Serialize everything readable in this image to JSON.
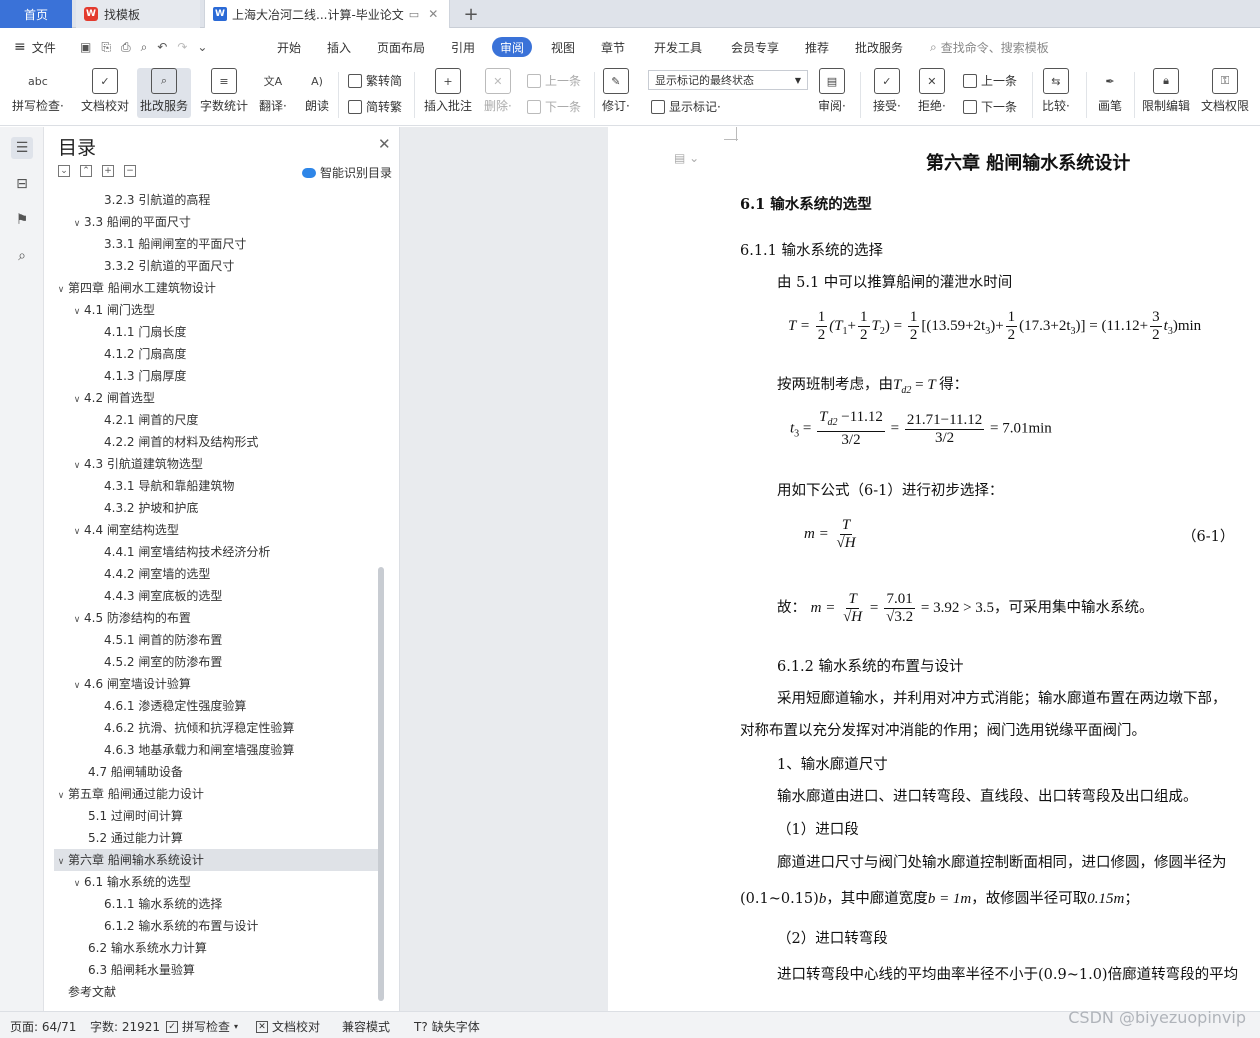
{
  "tabs": {
    "home": "首页",
    "find_template": "找模板",
    "doc": "上海大冶河二线...计算-毕业论文",
    "add": "+"
  },
  "menu": {
    "file": "文件",
    "items": [
      "开始",
      "插入",
      "页面布局",
      "引用",
      "审阅",
      "视图",
      "章节",
      "开发工具",
      "会员专享",
      "推荐",
      "批改服务"
    ],
    "search": "查找命令、搜索模板"
  },
  "ribbon": {
    "spell": "拼写检查·",
    "proof": "文档校对",
    "correct": "批改服务",
    "wordcount": "字数统计",
    "translate": "翻译·",
    "read": "朗读",
    "trad": "繁转简",
    "simp": "简转繁",
    "insert_comment": "插入批注",
    "delete": "删除·",
    "prev": "上一条",
    "next": "下一条",
    "revise": "修订·",
    "markup_state": "显示标记的最终状态",
    "show_markup": "显示标记·",
    "review": "审阅·",
    "accept": "接受·",
    "reject": "拒绝·",
    "prev2": "上一条",
    "next2": "下一条",
    "compare": "比较·",
    "pen": "画笔",
    "restrict": "限制编辑",
    "permission": "文档权限"
  },
  "toc": {
    "title": "目录",
    "smart": "智能识别目录",
    "items": [
      {
        "text": "3.2.3 引航道的高程",
        "level": 3,
        "chev": ""
      },
      {
        "text": "3.3 船闸的平面尺寸",
        "level": 2,
        "chev": "v"
      },
      {
        "text": "3.3.1 船闸闸室的平面尺寸",
        "level": 3,
        "chev": ""
      },
      {
        "text": "3.3.2 引航道的平面尺寸",
        "level": 3,
        "chev": ""
      },
      {
        "text": "第四章  船闸水工建筑物设计",
        "level": 1,
        "chev": "v"
      },
      {
        "text": "4.1 闸门选型",
        "level": 2,
        "chev": "v"
      },
      {
        "text": "4.1.1 门扇长度",
        "level": 3,
        "chev": ""
      },
      {
        "text": "4.1.2 门扇高度",
        "level": 3,
        "chev": ""
      },
      {
        "text": "4.1.3 门扇厚度",
        "level": 3,
        "chev": ""
      },
      {
        "text": "4.2 闸首选型",
        "level": 2,
        "chev": "v"
      },
      {
        "text": "4.2.1 闸首的尺度",
        "level": 3,
        "chev": ""
      },
      {
        "text": "4.2.2 闸首的材料及结构形式",
        "level": 3,
        "chev": ""
      },
      {
        "text": "4.3 引航道建筑物选型",
        "level": 2,
        "chev": "v"
      },
      {
        "text": "4.3.1 导航和靠船建筑物",
        "level": 3,
        "chev": ""
      },
      {
        "text": "4.3.2 护坡和护底",
        "level": 3,
        "chev": ""
      },
      {
        "text": "4.4 闸室结构选型",
        "level": 2,
        "chev": "v"
      },
      {
        "text": "4.4.1 闸室墙结构技术经济分析",
        "level": 3,
        "chev": ""
      },
      {
        "text": "4.4.2 闸室墙的选型",
        "level": 3,
        "chev": ""
      },
      {
        "text": "4.4.3 闸室底板的选型",
        "level": 3,
        "chev": ""
      },
      {
        "text": "4.5 防渗结构的布置",
        "level": 2,
        "chev": "v"
      },
      {
        "text": "4.5.1 闸首的防渗布置",
        "level": 3,
        "chev": ""
      },
      {
        "text": "4.5.2 闸室的防渗布置",
        "level": 3,
        "chev": ""
      },
      {
        "text": "4.6 闸室墙设计验算",
        "level": 2,
        "chev": "v"
      },
      {
        "text": "4.6.1 渗透稳定性强度验算",
        "level": 3,
        "chev": ""
      },
      {
        "text": "4.6.2 抗滑、抗倾和抗浮稳定性验算",
        "level": 3,
        "chev": ""
      },
      {
        "text": "4.6.3 地基承载力和闸室墙强度验算",
        "level": 3,
        "chev": ""
      },
      {
        "text": "4.7 船闸辅助设备",
        "level": 2,
        "chev": ""
      },
      {
        "text": "第五章  船闸通过能力设计",
        "level": 1,
        "chev": "v"
      },
      {
        "text": "5.1 过闸时间计算",
        "level": 2,
        "chev": ""
      },
      {
        "text": "5.2 通过能力计算",
        "level": 2,
        "chev": ""
      },
      {
        "text": "第六章  船闸输水系统设计",
        "level": 1,
        "chev": "v",
        "selected": true
      },
      {
        "text": "6.1 输水系统的选型",
        "level": 2,
        "chev": "v"
      },
      {
        "text": "6.1.1 输水系统的选择",
        "level": 3,
        "chev": ""
      },
      {
        "text": "6.1.2 输水系统的布置与设计",
        "level": 3,
        "chev": ""
      },
      {
        "text": "6.2 输水系统水力计算",
        "level": 2,
        "chev": ""
      },
      {
        "text": "6.3 船闸耗水量验算",
        "level": 2,
        "chev": ""
      },
      {
        "text": "参考文献",
        "level": 1,
        "chev": ""
      }
    ]
  },
  "doc": {
    "chapter": "第六章   船闸输水系统设计",
    "s61": "6.1 输水系统的选型",
    "s611": "6.1.1 输水系统的选择",
    "p1": "由 5.1 中可以推算船闸的灌泄水时间",
    "p2a": "按两班制考虑，由",
    "p2b": "得：",
    "p3": "用如下公式（6-1）进行初步选择：",
    "eqno": "（6-1）",
    "p4a": "故：",
    "p4b": "，可采用集中输水系统。",
    "s612": "6.1.2 输水系统的布置与设计",
    "p5": "采用短廊道输水，并利用对冲方式消能；输水廊道布置在两边墩下部，",
    "p6": "对称布置以充分发挥对冲消能的作用；阀门选用锐缘平面阀门。",
    "p7": "1、输水廊道尺寸",
    "p8": "输水廊道由进口、进口转弯段、直线段、出口转弯段及出口组成。",
    "p9": "（1）进口段",
    "p10": "廊道进口尺寸与阀门处输水廊道控制断面相同，进口修圆，修圆半径为",
    "p11a": "(0.1~0.15)",
    "p11b": "，其中廊道宽度",
    "p11c": "，故修圆半径可取",
    "p11d": "；",
    "p12": "（2）进口转弯段",
    "p13a": "进口转弯段中心线的平均曲率半径不小于",
    "p13b": "(0.9~1.0)",
    "p13c": "倍廊道转弯段的平均",
    "eq1": {
      "lhs": "T =",
      "f1": [
        "1",
        "2"
      ],
      "t1": "(T",
      "f2": [
        "1",
        "2"
      ],
      "t2": "T",
      "mid": ") =",
      "f3": [
        "1",
        "2"
      ],
      "b1": "[(13.59+2t",
      "b2": ")+",
      "f4": [
        "1",
        "2"
      ],
      "b3": "(17.3+2t",
      "b4": ")] = (11.12+",
      "f5": [
        "3",
        "2"
      ],
      "b5": "t",
      "b6": ")min"
    },
    "eq_td2": "T",
    "eq2": {
      "lhs": "t",
      "num1": "T",
      "num1b": " −11.12",
      "den1": "3/2",
      "num2": "21.71−11.12",
      "den2": "3/2",
      "res": "= 7.01min"
    },
    "eq3": {
      "lhs": "m =",
      "num": "T",
      "den": "√H"
    },
    "eq4": {
      "lhs": "m =",
      "num1": "T",
      "den1": "√H",
      "num2": "7.01",
      "den2": "√3.2",
      "res": "= 3.92 > 3.5"
    },
    "b_eq": "b = 1m",
    "r_eq": "0.15m"
  },
  "status": {
    "page": "页面: 64/71",
    "words": "字数: 21921",
    "spell": "拼写检查",
    "proof": "文档校对",
    "compat": "兼容模式",
    "font": "缺失字体"
  },
  "watermark": "CSDN @biyezuopinvip"
}
